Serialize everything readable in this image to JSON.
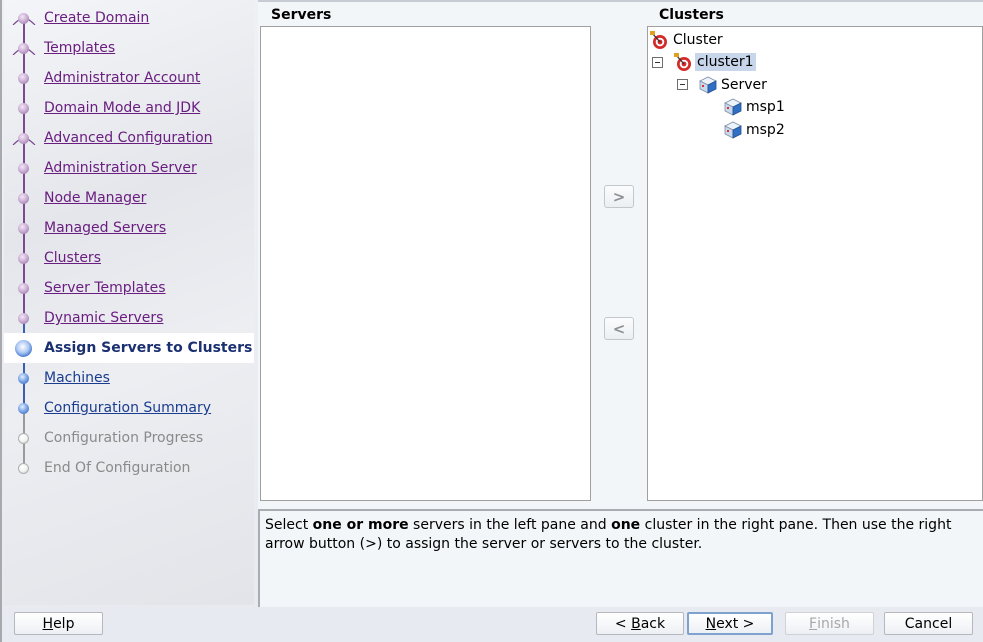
{
  "nav": {
    "items": [
      {
        "label": "Create Domain",
        "state": "done",
        "branch": true
      },
      {
        "label": "Templates",
        "state": "done",
        "branch": true
      },
      {
        "label": "Administrator Account",
        "state": "done",
        "branch": false
      },
      {
        "label": "Domain Mode and JDK",
        "state": "done",
        "branch": false
      },
      {
        "label": "Advanced Configuration",
        "state": "done",
        "branch": true
      },
      {
        "label": "Administration Server",
        "state": "done",
        "branch": false
      },
      {
        "label": "Node Manager",
        "state": "done",
        "branch": false
      },
      {
        "label": "Managed Servers",
        "state": "done",
        "branch": false
      },
      {
        "label": "Clusters",
        "state": "done",
        "branch": false
      },
      {
        "label": "Server Templates",
        "state": "done",
        "branch": false
      },
      {
        "label": "Dynamic Servers",
        "state": "done",
        "branch": false
      },
      {
        "label": "Assign Servers to Clusters",
        "state": "current",
        "branch": false
      },
      {
        "label": "Machines",
        "state": "next",
        "branch": false
      },
      {
        "label": "Configuration Summary",
        "state": "next",
        "branch": false
      },
      {
        "label": "Configuration Progress",
        "state": "todo",
        "branch": false
      },
      {
        "label": "End Of Configuration",
        "state": "todo",
        "branch": false
      }
    ]
  },
  "servers_pane": {
    "title": "Servers",
    "items": []
  },
  "clusters_pane": {
    "title": "Clusters",
    "tree": {
      "root": "Cluster",
      "cluster": "cluster1",
      "group": "Server",
      "servers": [
        "msp1",
        "msp2"
      ]
    }
  },
  "move_buttons": {
    "right": ">",
    "left": "<"
  },
  "help": {
    "parts": [
      {
        "text": "Select ",
        "bold": false
      },
      {
        "text": "one or more",
        "bold": true
      },
      {
        "text": " servers in the left pane and ",
        "bold": false
      },
      {
        "text": "one",
        "bold": true
      },
      {
        "text": " cluster in the right pane. Then use the right arrow button (>) to assign the server or servers to the cluster.",
        "bold": false
      }
    ]
  },
  "buttons": {
    "help": {
      "mnemonic": "H",
      "rest": "elp"
    },
    "back": {
      "prefix": "< ",
      "mnemonic": "B",
      "rest": "ack"
    },
    "next": {
      "mnemonic": "N",
      "rest": "ext >"
    },
    "finish": {
      "mnemonic": "F",
      "rest": "inish"
    },
    "cancel": {
      "label": "Cancel"
    }
  }
}
